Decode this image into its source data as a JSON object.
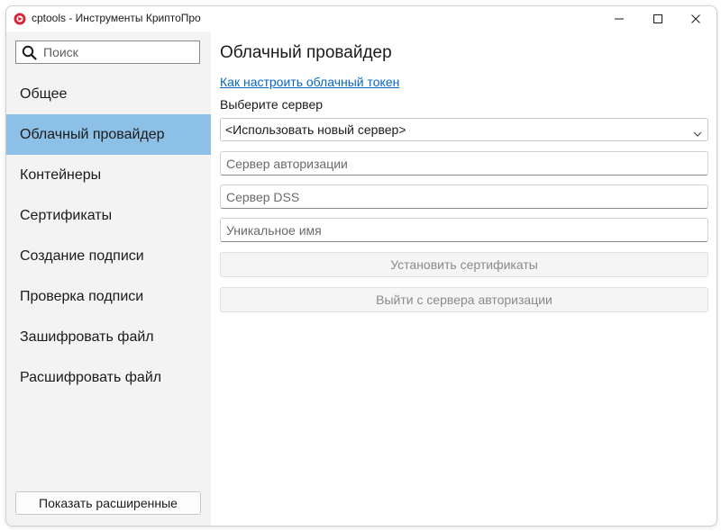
{
  "window": {
    "title": "cptools - Инструменты КриптоПро",
    "controls": {
      "minimize": "minimize-icon",
      "maximize": "maximize-icon",
      "close": "close-icon"
    }
  },
  "sidebar": {
    "search_placeholder": "Поиск",
    "items": [
      {
        "label": "Общее",
        "selected": false
      },
      {
        "label": "Облачный провайдер",
        "selected": true
      },
      {
        "label": "Контейнеры",
        "selected": false
      },
      {
        "label": "Сертификаты",
        "selected": false
      },
      {
        "label": "Создание подписи",
        "selected": false
      },
      {
        "label": "Проверка подписи",
        "selected": false
      },
      {
        "label": "Зашифровать файл",
        "selected": false
      },
      {
        "label": "Расшифровать файл",
        "selected": false
      }
    ],
    "show_advanced_label": "Показать расширенные"
  },
  "main": {
    "title": "Облачный провайдер",
    "help_link": "Как настроить облачный токен",
    "server_label": "Выберите сервер",
    "server_select_value": "<Использовать новый сервер>",
    "auth_server_placeholder": "Сервер авторизации",
    "dss_server_placeholder": "Сервер DSS",
    "unique_name_placeholder": "Уникальное имя",
    "install_certs_label": "Установить сертификаты",
    "logout_label": "Выйти с сервера авторизации"
  },
  "colors": {
    "selected_item": "#8cc0e6",
    "sidebar_bg": "#f3f3f3",
    "link": "#0a66c2",
    "disabled_text": "#8a8a8a",
    "app_icon_red": "#d3263a"
  }
}
